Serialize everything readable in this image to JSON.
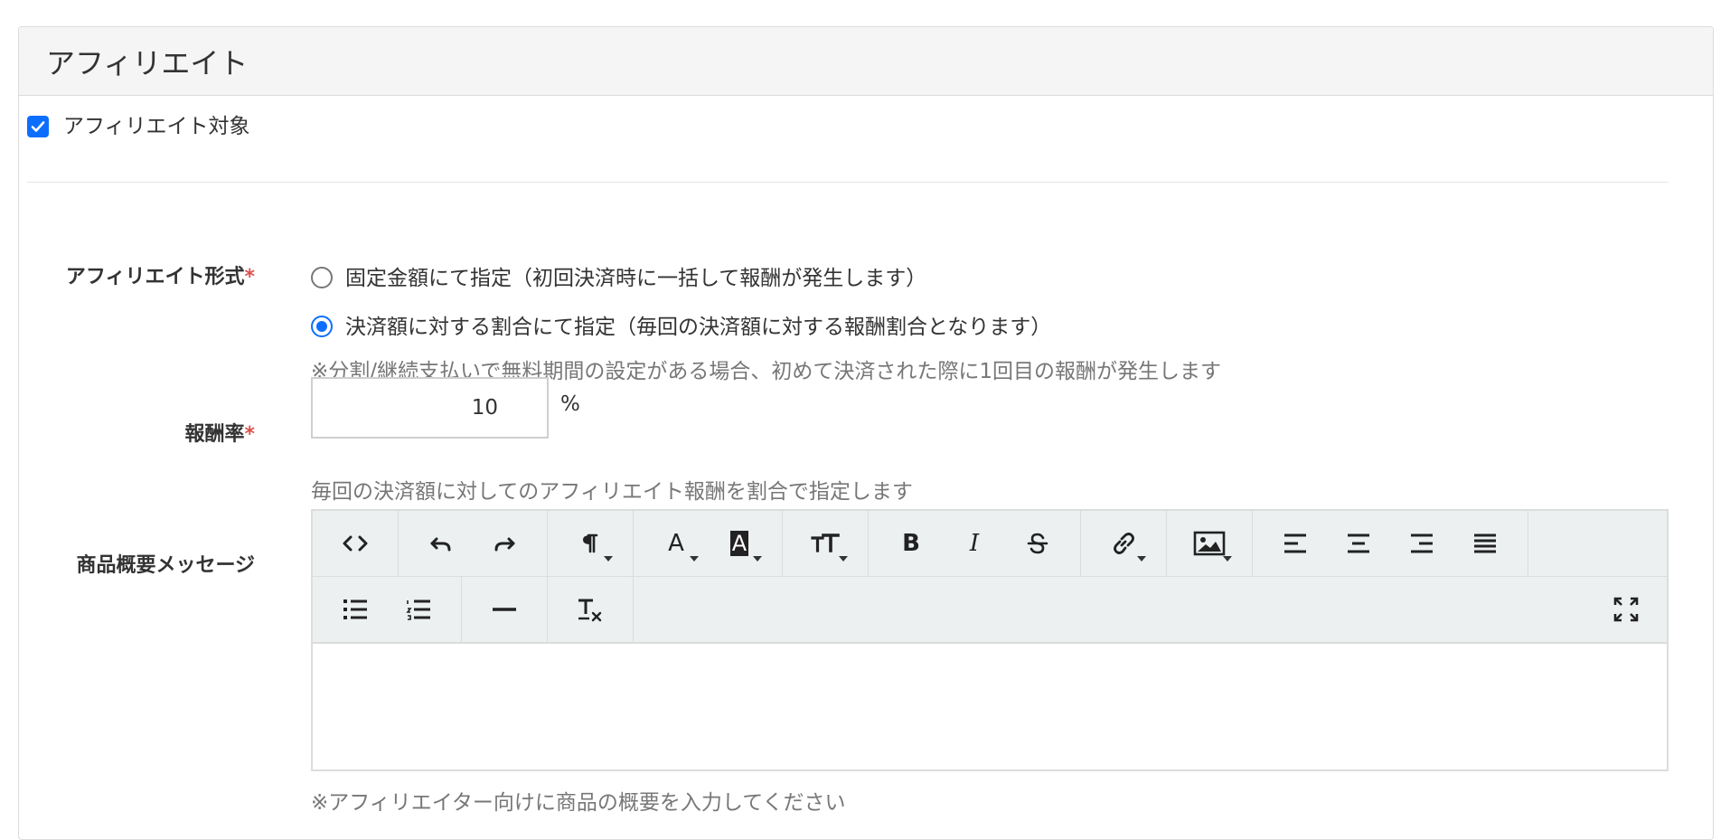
{
  "panel": {
    "title": "アフィリエイト"
  },
  "affiliate_target": {
    "label": "アフィリエイト対象",
    "checked": true
  },
  "affiliate_type": {
    "label": "アフィリエイト形式",
    "required_mark": "*",
    "options": [
      {
        "label": "固定金額にて指定（初回決済時に一括して報酬が発生します）",
        "selected": false
      },
      {
        "label": "決済額に対する割合にて指定（毎回の決済額に対する報酬割合となります）",
        "selected": true
      }
    ],
    "help": "※分割/継続支払いで無料期間の設定がある場合、初めて決済された際に1回目の報酬が発生します"
  },
  "reward_rate": {
    "label": "報酬率",
    "required_mark": "*",
    "value": "10",
    "unit": "%",
    "help": "毎回の決済額に対してのアフィリエイト報酬を割合で指定します"
  },
  "product_message": {
    "label": "商品概要メッセージ",
    "help": "※アフィリエイター向けに商品の概要を入力してください",
    "toolbar_text": {
      "bold": "B",
      "italic": "I",
      "font_color": "A",
      "bg_color": "A"
    }
  },
  "icons": [
    "code-view-icon",
    "undo-icon",
    "redo-icon",
    "paragraph-style-icon",
    "font-color-icon",
    "background-color-icon",
    "font-size-icon",
    "bold-icon",
    "italic-icon",
    "strikethrough-icon",
    "link-icon",
    "image-icon",
    "align-left-icon",
    "align-center-icon",
    "align-right-icon",
    "align-justify-icon",
    "unordered-list-icon",
    "ordered-list-icon",
    "horizontal-rule-icon",
    "clear-format-icon",
    "fullscreen-icon"
  ],
  "colors": {
    "accent": "#0d6efd",
    "required": "#d9534f",
    "toolbar_bg": "#ecf0f1",
    "heading_bg": "#f5f5f5"
  }
}
